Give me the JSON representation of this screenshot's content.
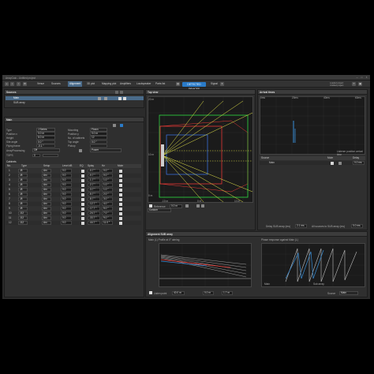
{
  "window": {
    "title": "ArrayCalc - Untitled project"
  },
  "toolbar": {
    "tabs": [
      {
        "label": "Venue",
        "active": false
      },
      {
        "label": "Sources",
        "active": false
      },
      {
        "label": "Alignment",
        "active": true
      },
      {
        "label": "3D plot",
        "active": false
      },
      {
        "label": "Mapping plot",
        "active": false
      },
      {
        "label": "Amplifiers",
        "active": false
      },
      {
        "label": "Loudspeaker",
        "active": false
      },
      {
        "label": "Parts list",
        "active": false
      }
    ],
    "status_badge": "DETECTED DEVICES",
    "signal_label": "Signal",
    "right_line1": "Loaded project",
    "right_line2": "Untitled project"
  },
  "sources": {
    "title": "Sources",
    "items": [
      {
        "label": "Main",
        "selected": true
      },
      {
        "label": "SUB array",
        "selected": false
      }
    ]
  },
  "main": {
    "title": "Main",
    "fields": [
      {
        "label": "Type",
        "value": "J Series",
        "label2": "Mounting",
        "value2": "Flown"
      },
      {
        "label": "Position x",
        "value": "0.0 m",
        "label2": "Position y",
        "value2": "0.0 m"
      },
      {
        "label": "Height",
        "value": "8.0 m",
        "label2": "No. of cabinets",
        "value2": "12"
      },
      {
        "label": "Site angle",
        "value": "0.0 °",
        "label2": "Top angle",
        "value2": "0.0 °"
      },
      {
        "label": "Flying frame",
        "value": "-0.1 °",
        "label2": "Pickup",
        "value2": ""
      }
    ],
    "array_processing": {
      "label": "ArrayProcessing",
      "value": "Off",
      "mode": "Power"
    },
    "tops_label": "TOPS",
    "tops_value": "0",
    "cabinets_title": "Cabinets",
    "cab_headers": [
      "No.",
      "Type",
      "Setup",
      "Level dB",
      "EQ",
      "Splay",
      "Hz",
      "Mute"
    ],
    "cabinets": [
      {
        "no": "1",
        "type": "J8",
        "setup": "Arc",
        "level": "0.0",
        "splay": "-0.7 °",
        "angle": "0.0 °"
      },
      {
        "no": "2",
        "type": "J8",
        "setup": "Arc",
        "level": "0.0",
        "splay": "-0.7 °",
        "angle": "0.0 °"
      },
      {
        "no": "3",
        "type": "J8",
        "setup": "Arc",
        "level": "0.0",
        "splay": "-1.7 °",
        "angle": "1.0 °"
      },
      {
        "no": "4",
        "type": "J8",
        "setup": "Arc",
        "level": "0.0",
        "splay": "-2.7 °",
        "angle": "1.0 °"
      },
      {
        "no": "5",
        "type": "J8",
        "setup": "Arc",
        "level": "0.0",
        "splay": "-3.7 °",
        "angle": "1.0 °"
      },
      {
        "no": "6",
        "type": "J8",
        "setup": "Arc",
        "level": "0.0",
        "splay": "-5.7 °",
        "angle": "2.0 °"
      },
      {
        "no": "7",
        "type": "J8",
        "setup": "Arc",
        "level": "0.0",
        "splay": "-8.7 °",
        "angle": "3.0 °"
      },
      {
        "no": "8",
        "type": "J8",
        "setup": "Arc",
        "level": "0.0",
        "splay": "-12.7 °",
        "angle": "4.0 °"
      },
      {
        "no": "9",
        "type": "J8",
        "setup": "Arc",
        "level": "0.0",
        "splay": "-17.7 °",
        "angle": "5.0 °"
      },
      {
        "no": "10",
        "type": "J12",
        "setup": "Arc",
        "level": "0.0",
        "splay": "-24.7 °",
        "angle": "7.0 °"
      },
      {
        "no": "11",
        "type": "J12",
        "setup": "Arc",
        "level": "0.0",
        "splay": "-33.7 °",
        "angle": "9.0 °"
      },
      {
        "no": "12",
        "type": "J12",
        "setup": "Arc",
        "level": "0.0",
        "splay": "-44.7 °",
        "angle": "11.0 °"
      }
    ]
  },
  "top_view": {
    "title": "Top view",
    "x_ticks": [
      "-10 m",
      "-5 m",
      "0 m",
      "5 m",
      "10 m",
      "15 m"
    ],
    "y_ticks": [
      "20 m",
      "15 m",
      "10 m",
      "5 m",
      "0 m"
    ],
    "footer_label": "Reference",
    "footer_value": "0.0 m",
    "reset_label": "Custom"
  },
  "arrival": {
    "title": "Arrival times",
    "x_ticks": [
      "0ms",
      "10ms",
      "20ms",
      "30ms",
      "40ms",
      "50ms",
      "60ms"
    ],
    "y_ticks": [
      "10 m",
      "15 m",
      "20 m",
      "25 m",
      "30 m",
      "35 m"
    ],
    "note": "Listener position arrival time",
    "table_headers": [
      "Source",
      "Mute",
      "Delay"
    ],
    "table_rows": [
      {
        "source": "Main",
        "delay": "0.0 ms"
      }
    ],
    "bottom_left": "Delay SUB array (ms)",
    "bottom_value": "2.1 ms",
    "bottom_right": "All sources to SUB array (ms)",
    "bottom_value2": "0.0 ms"
  },
  "alignment": {
    "title": "Alignment SUB array",
    "left_title": "Main (L) Profile at 0° aiming",
    "right_title": "Phase response against Main (L)",
    "left_footer_label": "Listen point",
    "left_footer_values": [
      "40.0 m",
      "0.0 m",
      "1.7 m"
    ],
    "right_footer_left": "Main",
    "right_footer_mid": "Sub array",
    "right_footer_right": "Source",
    "right_footer_value": "Main",
    "left_legend": [
      "Main",
      "SUB array"
    ]
  },
  "colors": {
    "accent": "#2a7bc8",
    "active_tab": "#4a6b8a",
    "green": "#2ecc40",
    "red": "#e53935",
    "yellow": "#e6e64a",
    "blue": "#3a6fd8"
  }
}
